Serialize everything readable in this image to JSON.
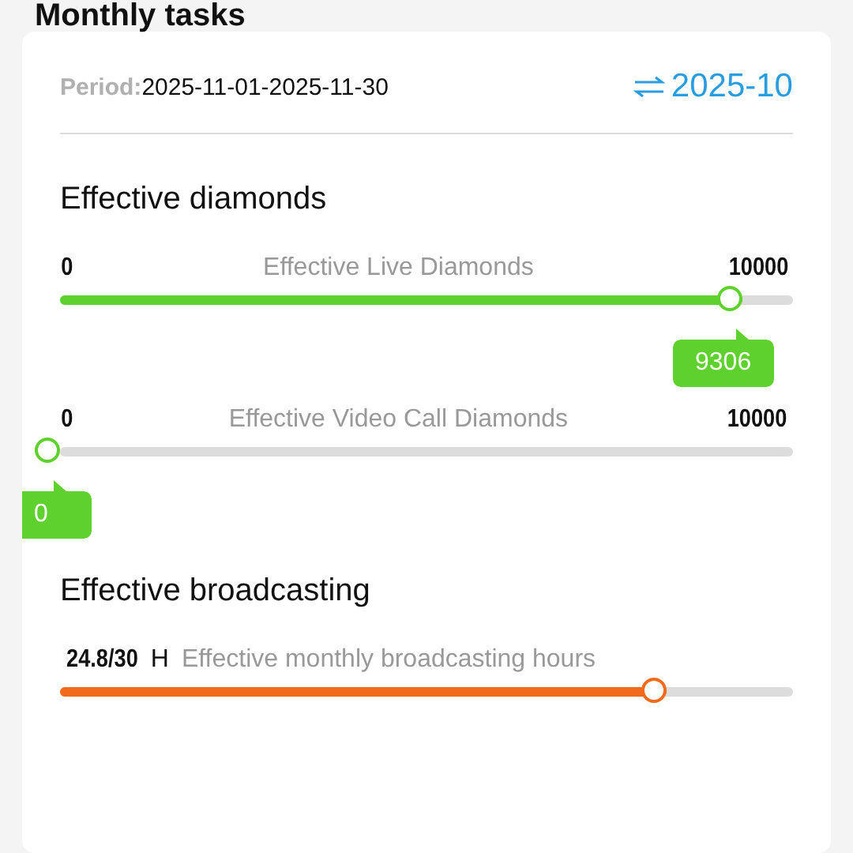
{
  "header": {
    "title": "Monthly tasks"
  },
  "period": {
    "label": "Period:",
    "value": "2025-11-01-2025-11-30",
    "switch_label": "2025-10"
  },
  "sections": [
    {
      "title": "Effective diamonds",
      "sliders": [
        {
          "kind": "range",
          "min": "0",
          "max": "10000",
          "caption": "Effective Live Diamonds",
          "level": 0.9306,
          "value": "9306",
          "color": "#5fd12f"
        },
        {
          "kind": "range",
          "min": "0",
          "max": "10000",
          "caption": "Effective Video Call Diamonds",
          "level": 0,
          "value": "0",
          "color": "#5fd12f"
        }
      ]
    },
    {
      "title": "Effective broadcasting",
      "sliders": [
        {
          "kind": "hours",
          "reading": "24.8/30",
          "unit": "H",
          "caption": "Effective monthly broadcasting hours",
          "level": 0.8267,
          "color": "#f26b1d"
        }
      ]
    }
  ]
}
